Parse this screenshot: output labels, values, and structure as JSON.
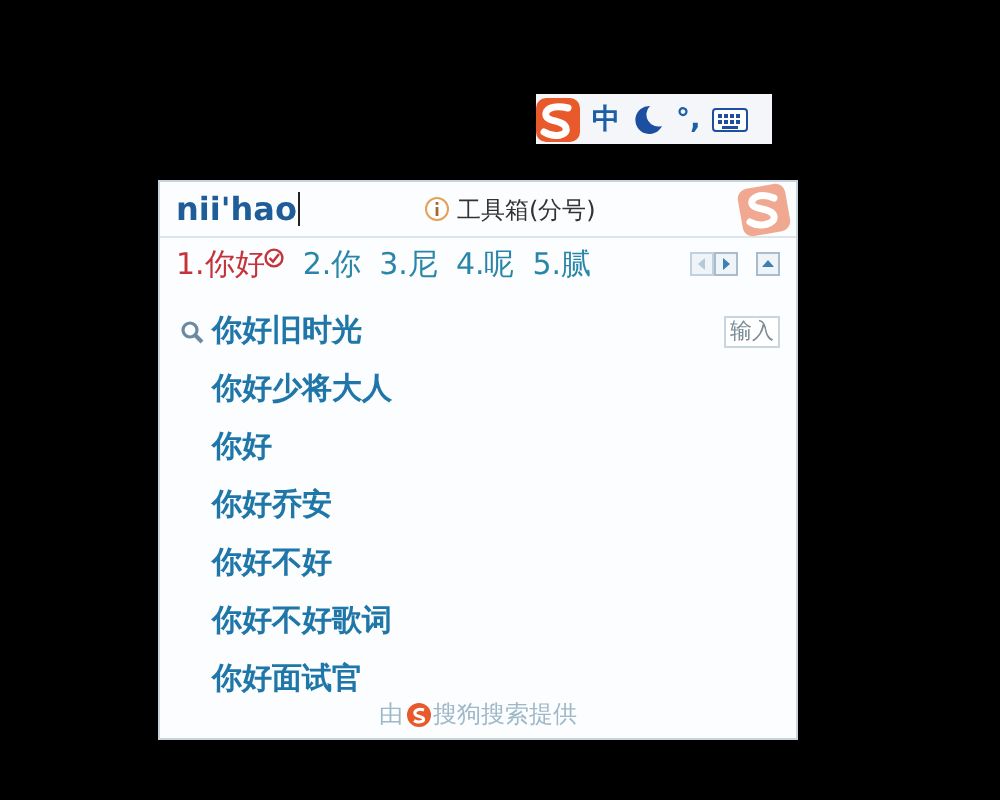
{
  "status_bar": {
    "mode": "中",
    "punctuation": "°,"
  },
  "candidate_window": {
    "composition": "nii'hao",
    "toolbox": "工具箱(分号)",
    "candidates": [
      {
        "number": "1.",
        "text": "你好",
        "selected": true
      },
      {
        "number": "2.",
        "text": "你",
        "selected": false
      },
      {
        "number": "3.",
        "text": "尼",
        "selected": false
      },
      {
        "number": "4.",
        "text": "呢",
        "selected": false
      },
      {
        "number": "5.",
        "text": "腻",
        "selected": false
      }
    ],
    "suggestions": [
      {
        "text": "你好旧时光",
        "action": "输入"
      },
      {
        "text": "你好少将大人"
      },
      {
        "text": "你好"
      },
      {
        "text": "你好乔安"
      },
      {
        "text": "你好不好"
      },
      {
        "text": "你好不好歌词"
      },
      {
        "text": "你好面试官"
      }
    ],
    "footer": {
      "prefix": "由",
      "text": "搜狗搜索提供"
    }
  }
}
